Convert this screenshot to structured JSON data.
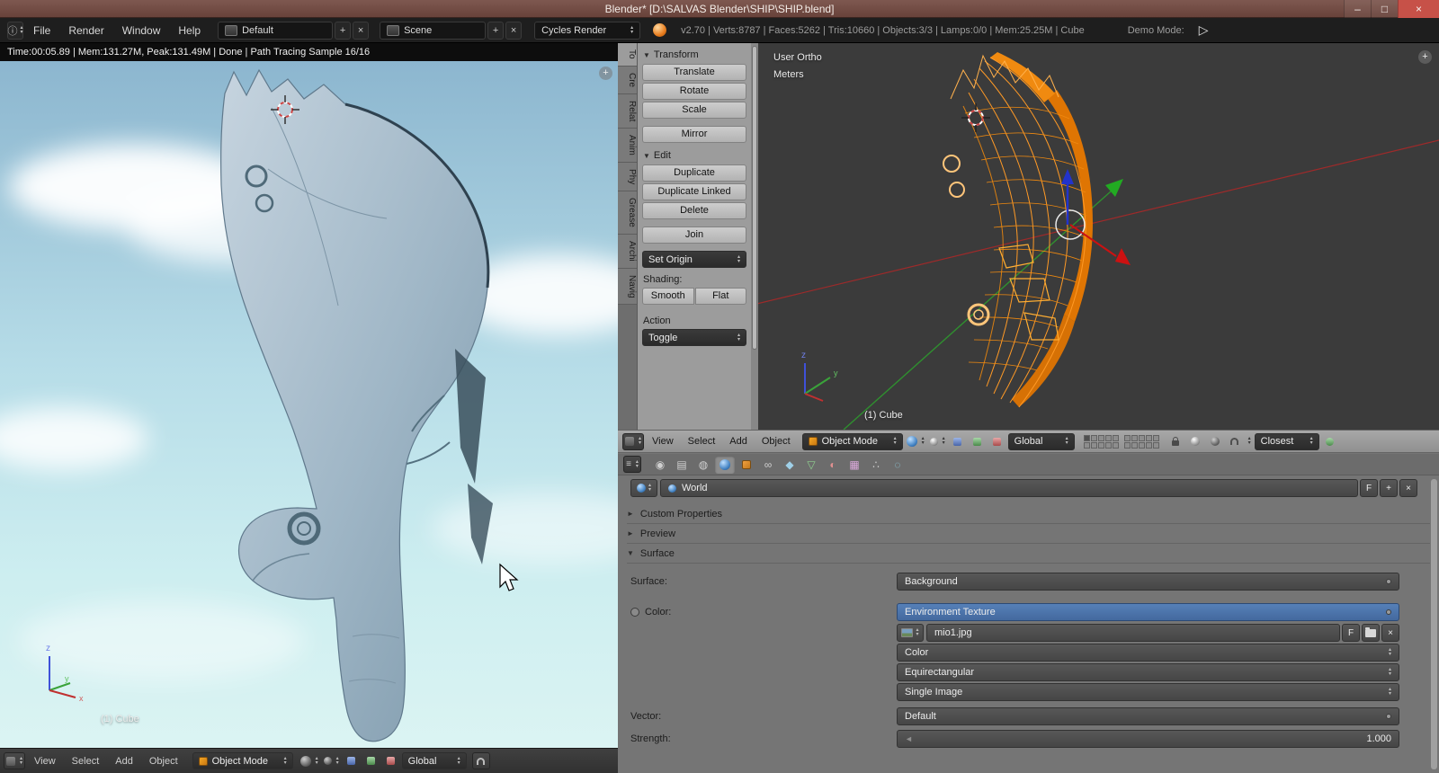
{
  "colors": {
    "accent_blue": "#4a6f9e",
    "selection_orange": "#ff9a26",
    "close_red": "#c75148",
    "viewport_dark": "#3b3b3b"
  },
  "titlebar": {
    "title": "Blender* [D:\\SALVAS Blender\\SHIP\\SHIP.blend]",
    "minimize": "–",
    "maximize": "□",
    "close": "×"
  },
  "menubar": {
    "menus": [
      "File",
      "Render",
      "Window",
      "Help"
    ],
    "layout_name": "Default",
    "scene_name": "Scene",
    "engine": "Cycles Render",
    "stats": "v2.70 | Verts:8787 | Faces:5262 | Tris:10660 | Objects:3/3 | Lamps:0/0 | Mem:25.25M | Cube",
    "demo_label": "Demo Mode:"
  },
  "render_view": {
    "status": "Time:00:05.89 | Mem:131.27M, Peak:131.49M | Done | Path Tracing Sample 16/16",
    "object_label": "(1) Cube",
    "header": {
      "menus": [
        "View",
        "Select",
        "Add",
        "Object"
      ],
      "mode": "Object Mode",
      "orientation": "Global"
    }
  },
  "tool_shelf": {
    "tabs": [
      "To",
      "Cre",
      "Relat",
      "Anim",
      "Phy",
      "Grease",
      "Archi",
      "Navig"
    ],
    "transform": {
      "title": "Transform",
      "buttons": [
        "Translate",
        "Rotate",
        "Scale",
        "Mirror"
      ]
    },
    "edit": {
      "title": "Edit",
      "buttons": [
        "Duplicate",
        "Duplicate Linked",
        "Delete",
        "Join"
      ],
      "set_origin": "Set Origin",
      "shading_label": "Shading:",
      "smooth": "Smooth",
      "flat": "Flat"
    },
    "action_label": "Action",
    "action_value": "Toggle"
  },
  "wire_view": {
    "view_name": "User Ortho",
    "unit": "Meters",
    "object_label": "(1) Cube",
    "header": {
      "menus": [
        "View",
        "Select",
        "Add",
        "Object"
      ],
      "mode": "Object Mode",
      "orientation": "Global",
      "snap_target": "Closest"
    }
  },
  "properties": {
    "world_name": "World",
    "fake_user": "F",
    "panels": {
      "custom_properties": "Custom Properties",
      "preview": "Preview",
      "surface": "Surface"
    },
    "surface_label": "Surface:",
    "surface_value": "Background",
    "color_label": "Color:",
    "color_value": "Environment Texture",
    "image_name": "mio1.jpg",
    "image_fake_user": "F",
    "color_space": "Color",
    "projection": "Equirectangular",
    "image_source": "Single Image",
    "vector_label": "Vector:",
    "vector_value": "Default",
    "strength_label": "Strength:",
    "strength_value": "1.000"
  }
}
